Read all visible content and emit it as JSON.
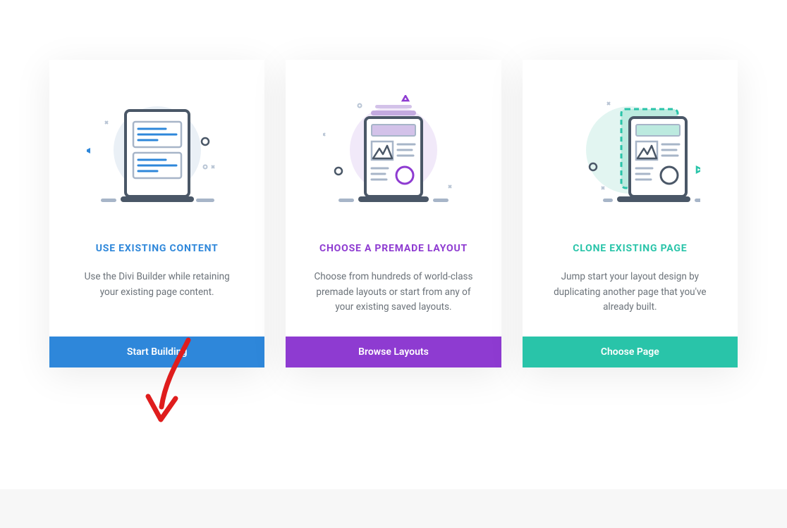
{
  "cards": [
    {
      "title": "USE EXISTING CONTENT",
      "description": "Use the Divi Builder while retaining your existing page content.",
      "button": "Start Building",
      "theme": "blue"
    },
    {
      "title": "CHOOSE A PREMADE LAYOUT",
      "description": "Choose from hundreds of world-class premade layouts or start from any of your existing saved layouts.",
      "button": "Browse Layouts",
      "theme": "purple"
    },
    {
      "title": "CLONE EXISTING PAGE",
      "description": "Jump start your layout design by duplicating another page that you've already built.",
      "button": "Choose Page",
      "theme": "teal"
    }
  ]
}
